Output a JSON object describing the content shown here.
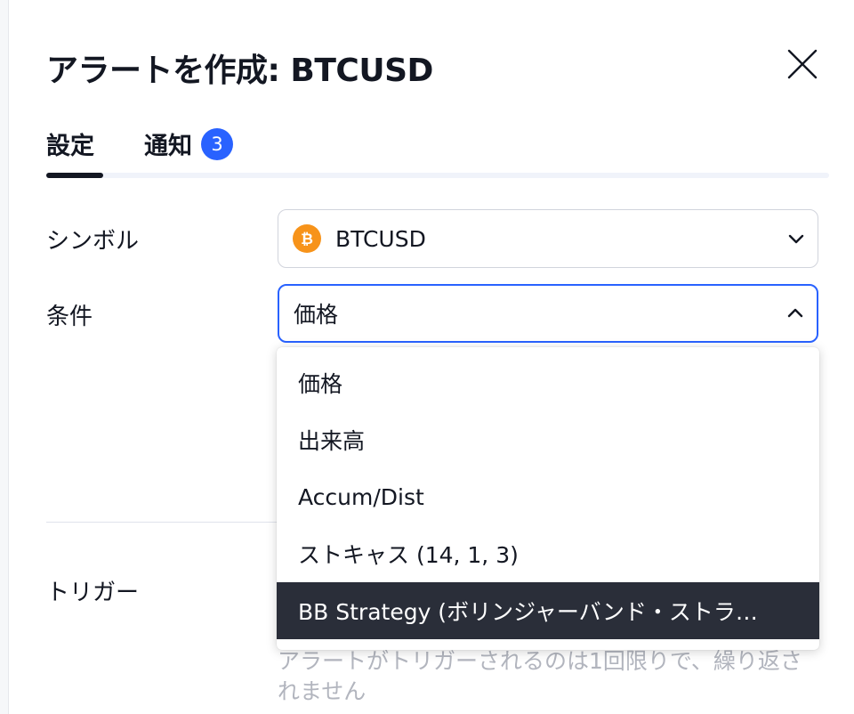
{
  "dialog": {
    "title": "アラートを作成: BTCUSD",
    "close_icon": "close-icon"
  },
  "tabs": [
    {
      "label": "設定",
      "active": true
    },
    {
      "label": "通知",
      "badge": "3"
    }
  ],
  "colors": {
    "accent": "#2962ff",
    "text": "#131722",
    "bitcoin": "#f7931a",
    "selected_bg": "#2a2e39",
    "muted": "#b2b5be"
  },
  "symbol": {
    "label": "シンボル",
    "value": "BTCUSD",
    "icon": "bitcoin-icon"
  },
  "condition": {
    "label": "条件",
    "value": "価格",
    "options": [
      "価格",
      "出来高",
      "Accum/Dist",
      "ストキャス (14, 1, 3)",
      "BB Strategy (ボリンジャーバンド・ストラ…"
    ],
    "highlighted_index": 4
  },
  "trigger": {
    "label": "トリガー",
    "hint": "アラートがトリガーされるのは1回限りで、繰り返されません"
  }
}
